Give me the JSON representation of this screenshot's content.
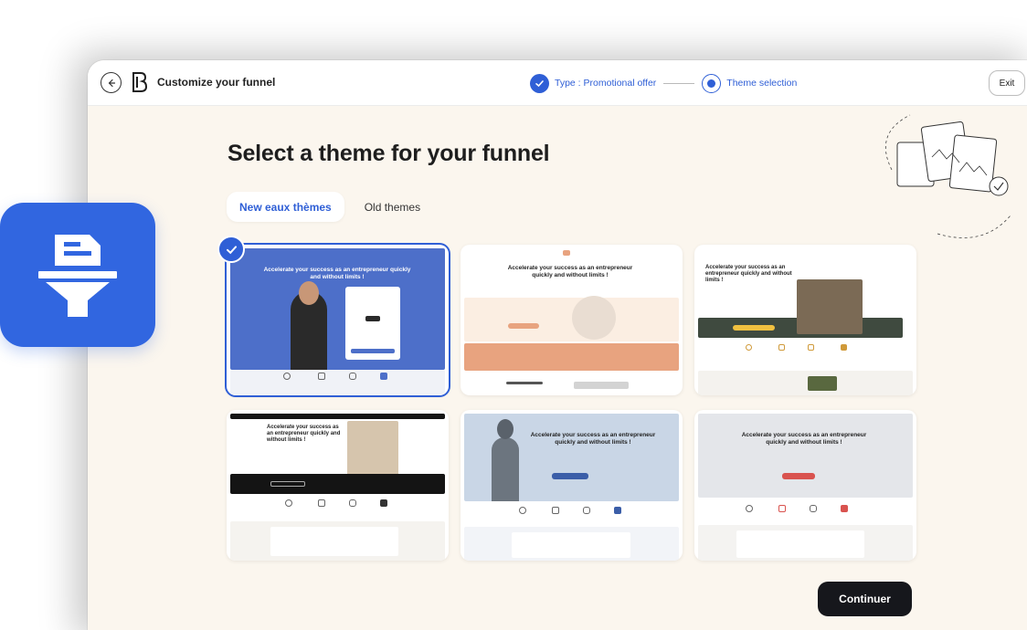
{
  "header": {
    "title": "Customize your funnel",
    "steps": [
      {
        "label": "Type : Promotional offer",
        "state": "done"
      },
      {
        "label": "Theme selection",
        "state": "current"
      }
    ],
    "exit_label": "Exit"
  },
  "main": {
    "heading": "Select a theme for your funnel",
    "tabs": [
      {
        "label": "New eaux thèmes",
        "active": true
      },
      {
        "label": "Old themes",
        "active": false
      }
    ],
    "themes": [
      {
        "preview_title": "Accelerate your success as an entrepreneur quickly and without limits !",
        "selected": true,
        "accent": "#4d6fc9"
      },
      {
        "preview_title": "Accelerate your success as an entrepreneur quickly and without limits !",
        "selected": false,
        "accent": "#e8a37f"
      },
      {
        "preview_title": "Accelerate your success as an entrepreneur quickly and without limits !",
        "selected": false,
        "accent": "#3f4a3f"
      },
      {
        "preview_title": "Accelerate your success as an entrepreneur quickly and without limits !",
        "selected": false,
        "accent": "#141414"
      },
      {
        "preview_title": "Accelerate your success as an entrepreneur quickly and without limits !",
        "selected": false,
        "accent": "#3b5ea8"
      },
      {
        "preview_title": "Accelerate your success as an entrepreneur quickly and without limits !",
        "selected": false,
        "accent": "#d9534f"
      }
    ],
    "continue_label": "Continuer"
  },
  "colors": {
    "primary": "#2f5fd6",
    "background": "#fbf6ee",
    "dark_button": "#16171c",
    "app_icon": "#3166e0"
  },
  "icons": [
    "back-arrow-icon",
    "logo-icon",
    "check-icon",
    "funnel-document-icon"
  ]
}
